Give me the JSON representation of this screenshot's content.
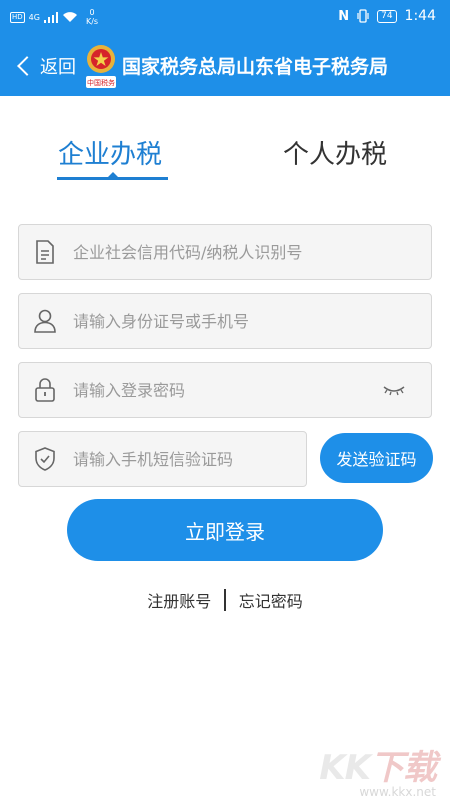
{
  "status_bar": {
    "hd_badge": "HD",
    "network": "4G",
    "speed_value": "0",
    "speed_unit": "K/s",
    "nfc": "N",
    "battery": "74",
    "time": "1:44"
  },
  "header": {
    "back_label": "返回",
    "title": "国家税务总局山东省电子税务局",
    "emblem_text": "中国税务",
    "background": "#1e8fe8"
  },
  "tabs": [
    {
      "label": "企业办税",
      "active": true
    },
    {
      "label": "个人办税",
      "active": false
    }
  ],
  "form": {
    "credit_code": {
      "placeholder": "企业社会信用代码/纳税人识别号",
      "value": "",
      "icon": "document-icon"
    },
    "id_or_phone": {
      "placeholder": "请输入身份证号或手机号",
      "value": "",
      "icon": "user-icon"
    },
    "password": {
      "placeholder": "请输入登录密码",
      "value": "",
      "icon": "lock-icon"
    },
    "sms_code": {
      "placeholder": "请输入手机短信验证码",
      "value": "",
      "icon": "shield-icon"
    },
    "send_code_label": "发送验证码",
    "login_label": "立即登录"
  },
  "links": {
    "register": "注册账号",
    "forgot": "忘记密码"
  },
  "watermark": {
    "logo_k1": "K",
    "logo_k2": "K",
    "logo_dl": "下载",
    "url": "www.kkx.net"
  },
  "colors": {
    "accent": "#1e8fe8",
    "active_tab": "#1e7fd2"
  }
}
